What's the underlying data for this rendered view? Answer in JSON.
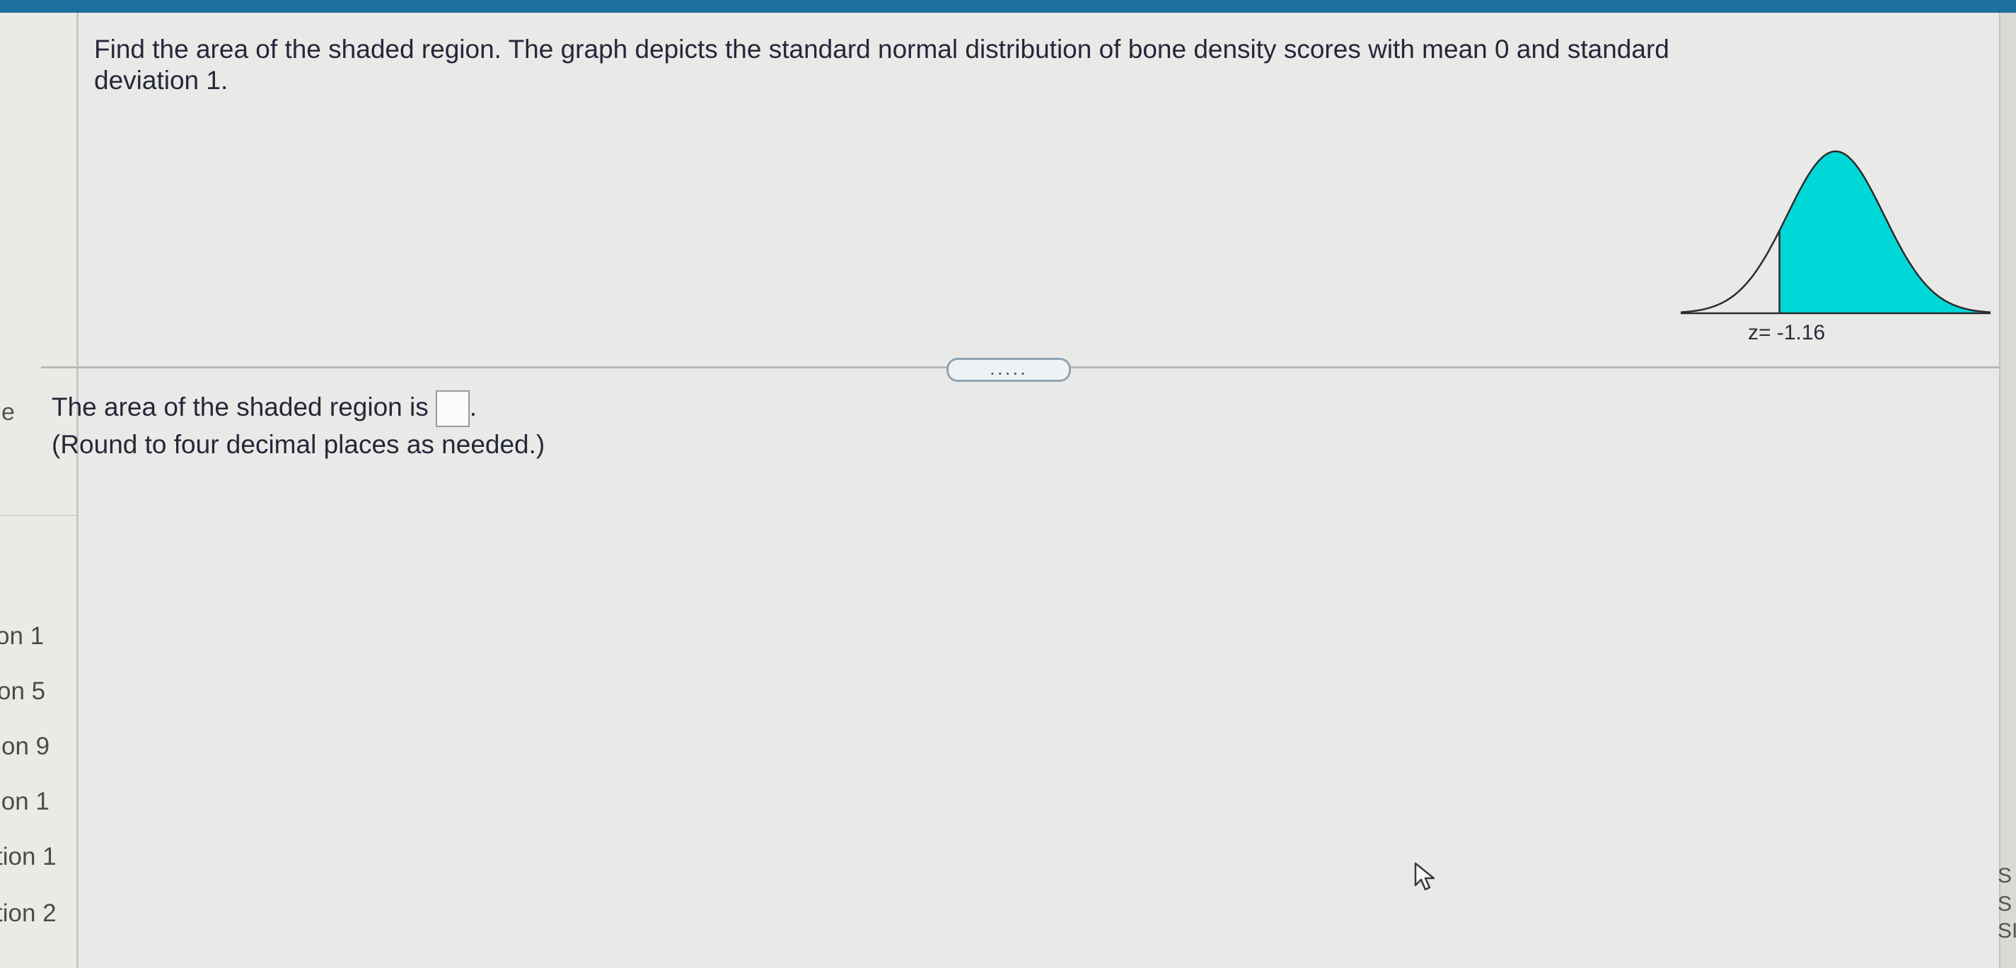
{
  "question": {
    "text": "Find the area of the shaded region. The graph depicts the standard normal distribution of bone density scores with mean 0 and standard deviation 1."
  },
  "graph": {
    "z_label": "z= -1.16",
    "fill_color": "#00d8d8"
  },
  "tools": [
    {
      "name": "zoom-in-icon"
    },
    {
      "name": "zoom-out-icon"
    },
    {
      "name": "external-link-icon"
    }
  ],
  "expander": {
    "label": "....."
  },
  "answer": {
    "prefix": "The area of the shaded region is",
    "suffix": ".",
    "value": "",
    "hint": "(Round to four decimal places as needed.)"
  },
  "left_nav": {
    "letter": "e",
    "items": [
      "on 1",
      "on 5",
      "on 9",
      "ion 1",
      "tion 1",
      "tion 2"
    ]
  },
  "right_strip": {
    "items": [
      "S",
      "S",
      "SI"
    ]
  }
}
